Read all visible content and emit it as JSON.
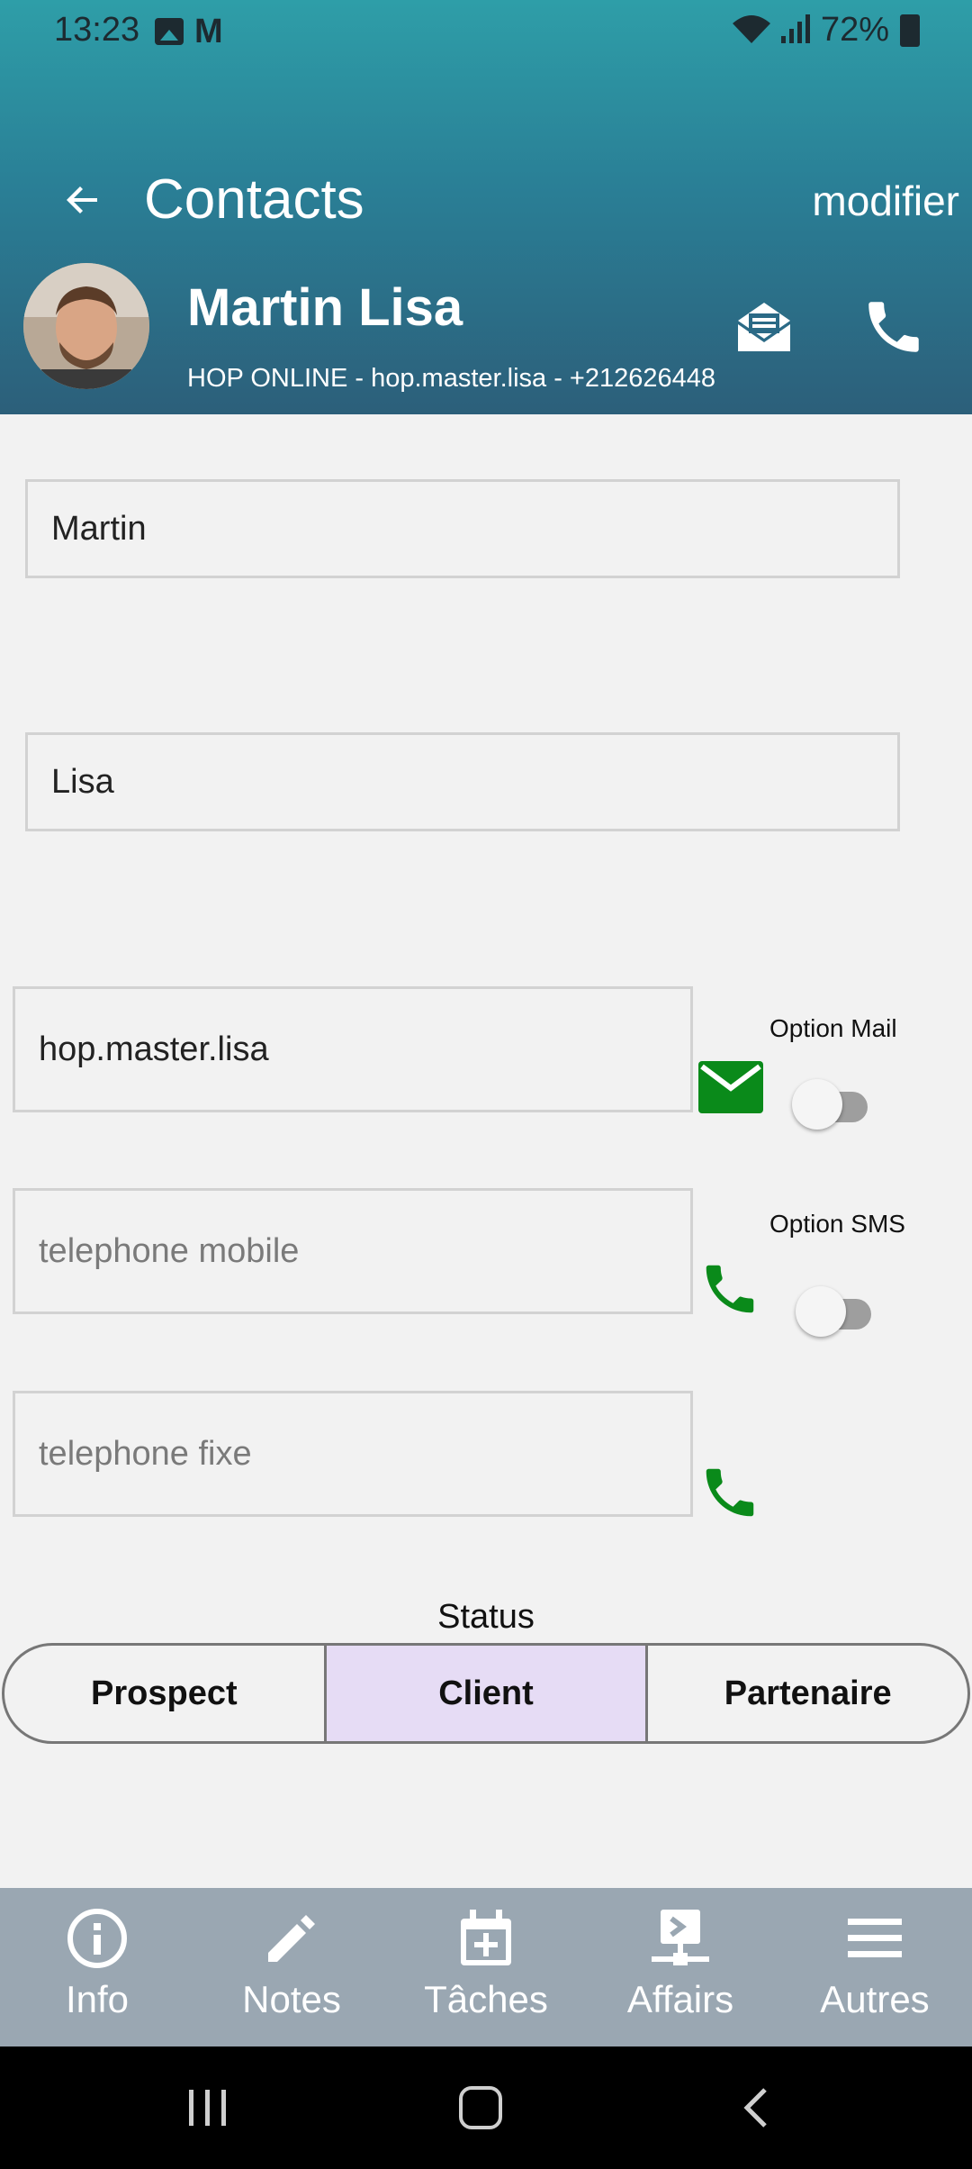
{
  "status_bar": {
    "time": "13:23",
    "battery": "72%",
    "mail_glyph": "M"
  },
  "header": {
    "title": "Contacts",
    "edit_label": "modifier",
    "contact_name": "Martin Lisa",
    "contact_subtitle": "HOP ONLINE - hop.master.lisa - +212626448"
  },
  "form": {
    "last_name": {
      "value": "Martin",
      "placeholder": ""
    },
    "first_name": {
      "value": "Lisa",
      "placeholder": ""
    },
    "email": {
      "value": "hop.master.lisa",
      "placeholder": ""
    },
    "mobile": {
      "value": "",
      "placeholder": "telephone mobile"
    },
    "landline": {
      "value": "",
      "placeholder": "telephone fixe"
    },
    "option_mail_label": "Option Mail",
    "option_mail_on": false,
    "option_sms_label": "Option SMS",
    "option_sms_on": false
  },
  "status": {
    "title": "Status",
    "options": [
      "Prospect",
      "Client",
      "Partenaire"
    ],
    "selected": "Client"
  },
  "bottom_nav": [
    {
      "label": "Info",
      "icon": "info-icon"
    },
    {
      "label": "Notes",
      "icon": "pencil-icon"
    },
    {
      "label": "Tâches",
      "icon": "calendar-add-icon"
    },
    {
      "label": "Affairs",
      "icon": "network-icon"
    },
    {
      "label": "Autres",
      "icon": "menu-icon"
    }
  ],
  "colors": {
    "header_top": "#2e9ea8",
    "header_bottom": "#2c5f7a",
    "action_green": "#0a8a1a",
    "segment_selected": "#e6dcf5",
    "bottom_nav_bg": "#9aa7b2"
  }
}
